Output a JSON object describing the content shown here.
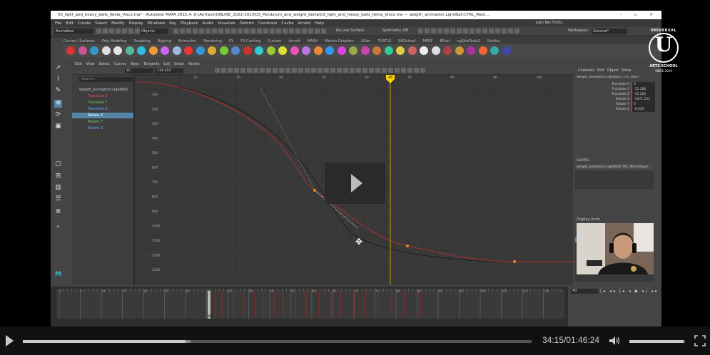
{
  "window": {
    "title": "03_light_and_heavy_balls_Ilenia_Visco.ma* - Autodesk MAYA 2022.4: D:\\Anfrank\\ONLINE_2022-2023\\03_Pendulum_and_weight_Ilenia\\03_light_and_heavy_balls_Ilenia_Visco.ma --- weigth_animation:LightBall:CTRL_Main..."
  },
  "menubar": [
    "File",
    "Edit",
    "Create",
    "Select",
    "Modify",
    "Display",
    "Windows",
    "Key",
    "Playback",
    "Audio",
    "Visualize",
    "Deform",
    "Constrain",
    "Cache",
    "Arnold",
    "Help"
  ],
  "status": {
    "mode": "Animation",
    "objects": "Objects",
    "no_live_surface": "No Live Surface",
    "symmetry": "Symmetry: Off",
    "workspace_label": "Workspace:",
    "workspace_value": "General*",
    "user": "Juan Bec Fonts"
  },
  "shelf_tabs": [
    "Curves / Surfaces",
    "Poly Modeling",
    "Sculpting",
    "Rigging",
    "Animation",
    "Rendering",
    "FX",
    "FX Caching",
    "Custom",
    "Arnold",
    "MASH",
    "Motion Graphics",
    "XGen",
    "TURTLE",
    "SiKSchool",
    "MERF",
    "BRrot",
    "ngSkinTools2",
    "Rumba"
  ],
  "graph_editor": {
    "menu": [
      "Edit",
      "View",
      "Select",
      "Curves",
      "Keys",
      "Tangents",
      "List",
      "Show",
      "Panels"
    ],
    "frame_field": "40",
    "value_field": "-708.004",
    "search_placeholder": "Search...",
    "outliner": [
      {
        "label": "weigth_animation:LightBall",
        "color": "#ccc",
        "selected": false
      },
      {
        "label": "Translate X",
        "color": "#e05050",
        "selected": false
      },
      {
        "label": "Translate Y",
        "color": "#5fd05f",
        "selected": false
      },
      {
        "label": "Translate Z",
        "color": "#5fa0ff",
        "selected": false
      },
      {
        "label": "Rotate X",
        "color": "#ffffff",
        "selected": true
      },
      {
        "label": "Rotate Y",
        "color": "#5fd05f",
        "selected": false
      },
      {
        "label": "Rotate Z",
        "color": "#5fa0ff",
        "selected": false
      }
    ],
    "y_ticks": [
      "-100",
      "-200",
      "-300",
      "-400",
      "-500",
      "-600",
      "-700",
      "-800",
      "-900",
      "-1000",
      "-1100",
      "-1200",
      "-1300"
    ],
    "x_ticks": [
      "20",
      "30",
      "40",
      "50",
      "60",
      "70",
      "80",
      "90",
      "100"
    ],
    "current_frame": "48"
  },
  "channel_box": {
    "menu": [
      "Channels",
      "Edit",
      "Object",
      "Show"
    ],
    "object": "weigth_animation:LightBall:CTRL_Main",
    "channels": [
      {
        "label": "Translate X",
        "value": "0"
      },
      {
        "label": "Translate Y",
        "value": "-12.282"
      },
      {
        "label": "Translate Z",
        "value": "-10.281"
      },
      {
        "label": "Rotate X",
        "value": "-1071.121"
      },
      {
        "label": "Rotate Y",
        "value": "0"
      },
      {
        "label": "Rotate Z",
        "value": "-0.029"
      }
    ],
    "shapes_label": "SHAPES",
    "shape_name": "weigth_animation:LightBallCTRL_MainShape",
    "layer_tabs": "Display   Anim",
    "layer_menu": [
      "Layers",
      "Options",
      "Help"
    ],
    "layer_name": "platforms"
  },
  "playback": {
    "current_frame": "40",
    "controls": "|◂ ◂◂ |◂ ◂ ▶ ▸| ▸▸ ▸|"
  },
  "timeline_ticks": [
    "1",
    "5",
    "10",
    "15",
    "20",
    "25",
    "30",
    "35",
    "40",
    "45",
    "50",
    "55",
    "60",
    "65",
    "70",
    "75",
    "80",
    "85",
    "90",
    "95",
    "100",
    "105",
    "110",
    "115",
    "120"
  ],
  "timeline_marker": "40",
  "logo": {
    "top": "UNIVERSAL",
    "letter": "U",
    "mid": "ARTS SCHOOL",
    "bottom": "SINCE 2019"
  },
  "video": {
    "timecode": "34:15/01:46:24",
    "progress": 0.32,
    "buffered": 0.33,
    "volume": 0.98
  }
}
